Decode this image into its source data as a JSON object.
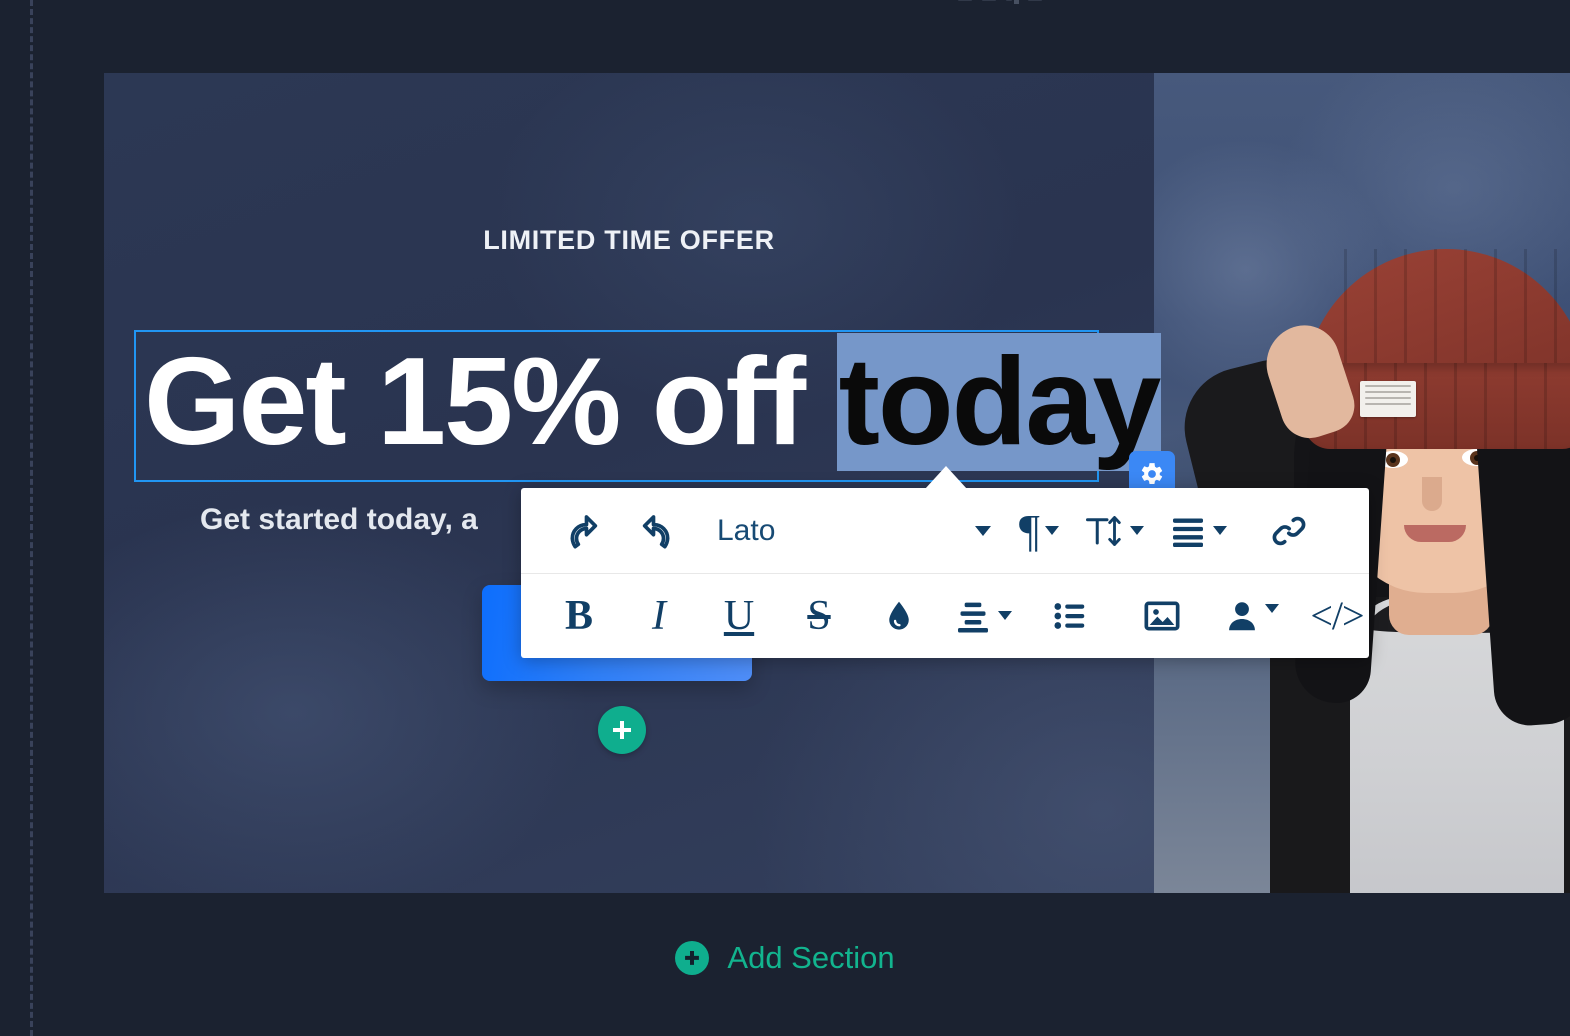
{
  "canvas": {
    "guide_label": "canvas-left-guide"
  },
  "hero": {
    "eyebrow": "LIMITED TIME OFFER",
    "headline_prefix": "Get 15% off ",
    "headline_selected": "today",
    "subheadline": "Get started today, a",
    "cta_label": "",
    "photo_alt": "woman-in-red-beanie"
  },
  "toolbar": {
    "undo_label": "undo-icon",
    "redo_label": "redo-icon",
    "font_family": "Lato",
    "font_caret": "chevron-down-icon",
    "paragraph_label": "¶",
    "font_size_label": "T",
    "align_label": "align-icon",
    "link_label": "link-icon",
    "bold_label": "B",
    "italic_label": "I",
    "underline_label": "U",
    "strikethrough_label": "S",
    "color_label": "text-color-icon",
    "line_height_label": "line-height-icon",
    "list_label": "bullet-list-icon",
    "image_label": "image-icon",
    "personalize_label": "personalization-icon",
    "code_label": "</>"
  },
  "buttons": {
    "settings_label": "gear-icon",
    "add_block_label": "add-block-plus",
    "add_section_label": "Add Section",
    "add_section_icon": "plus-circle-icon"
  },
  "colors": {
    "page_background": "#1b2230",
    "hero_background": "#2b3751",
    "selection_highlight": "#7697c9",
    "selection_text": "#0a0a0a",
    "text_box_border": "#2196f3",
    "toolbar_icon": "#113f66",
    "accent_teal": "#0fae8e",
    "accent_blue": "#0d6efd",
    "settings_blue": "#3b88f5",
    "beanie_red": "#8e3b30"
  }
}
